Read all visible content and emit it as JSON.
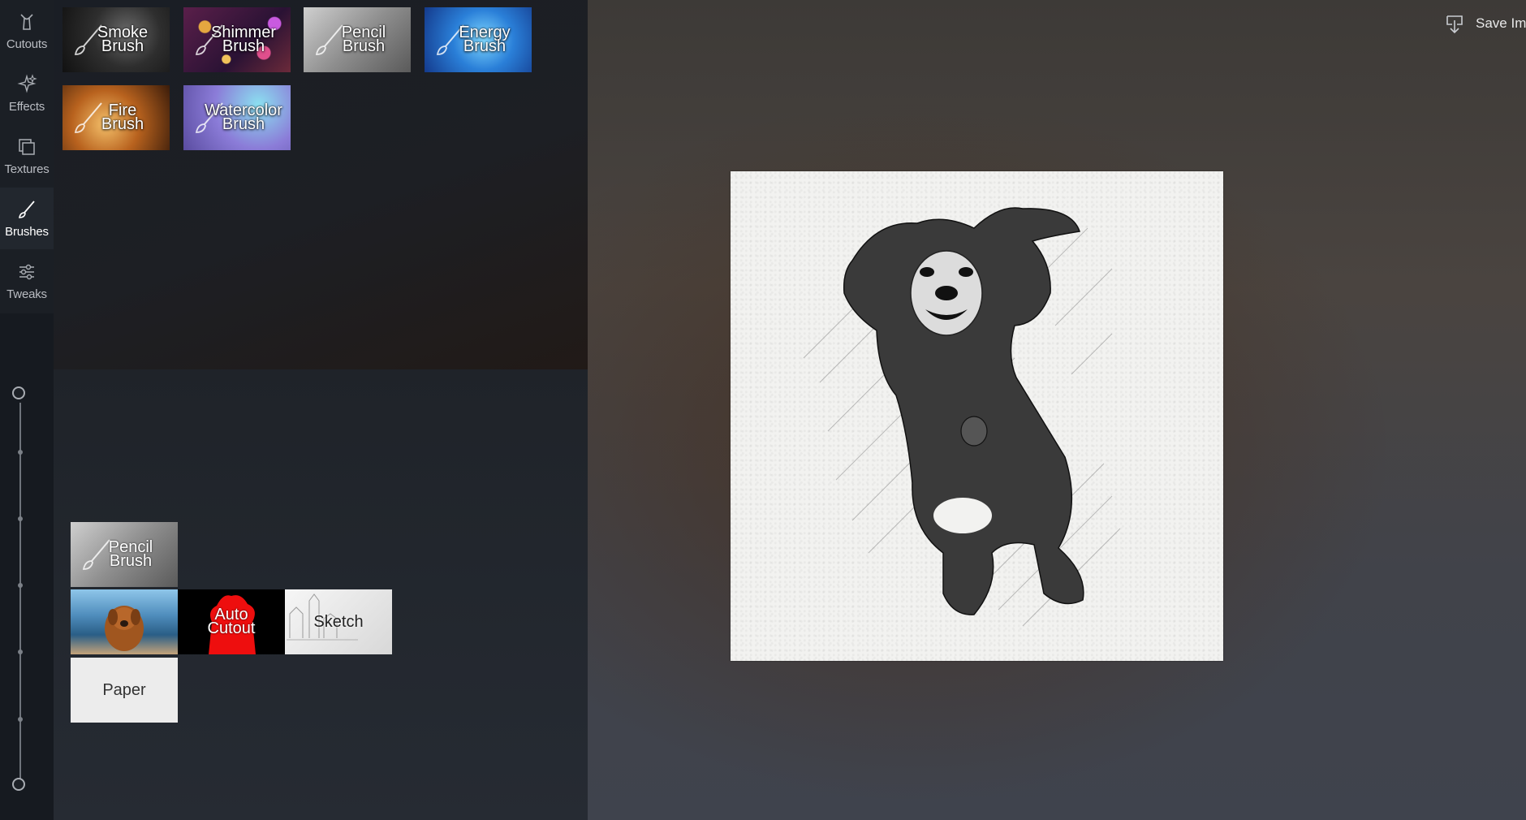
{
  "nav": {
    "items": [
      {
        "label": "Cutouts",
        "icon": "cutout-icon"
      },
      {
        "label": "Effects",
        "icon": "sparkle-icon"
      },
      {
        "label": "Textures",
        "icon": "layers-icon"
      },
      {
        "label": "Brushes",
        "icon": "brush-icon"
      },
      {
        "label": "Tweaks",
        "icon": "sliders-icon"
      }
    ],
    "active": "Brushes"
  },
  "brushes": [
    {
      "label": "Smoke\nBrush"
    },
    {
      "label": "Shimmer\nBrush"
    },
    {
      "label": "Pencil\nBrush"
    },
    {
      "label": "Energy\nBrush"
    },
    {
      "label": "Fire\nBrush"
    },
    {
      "label": "Watercolor\nBrush"
    }
  ],
  "layers": {
    "pencil": "Pencil\nBrush",
    "auto_cutout": "Auto\nCutout",
    "sketch": "Sketch",
    "paper": "Paper"
  },
  "toolbar": {
    "save_label": "Save Image"
  }
}
